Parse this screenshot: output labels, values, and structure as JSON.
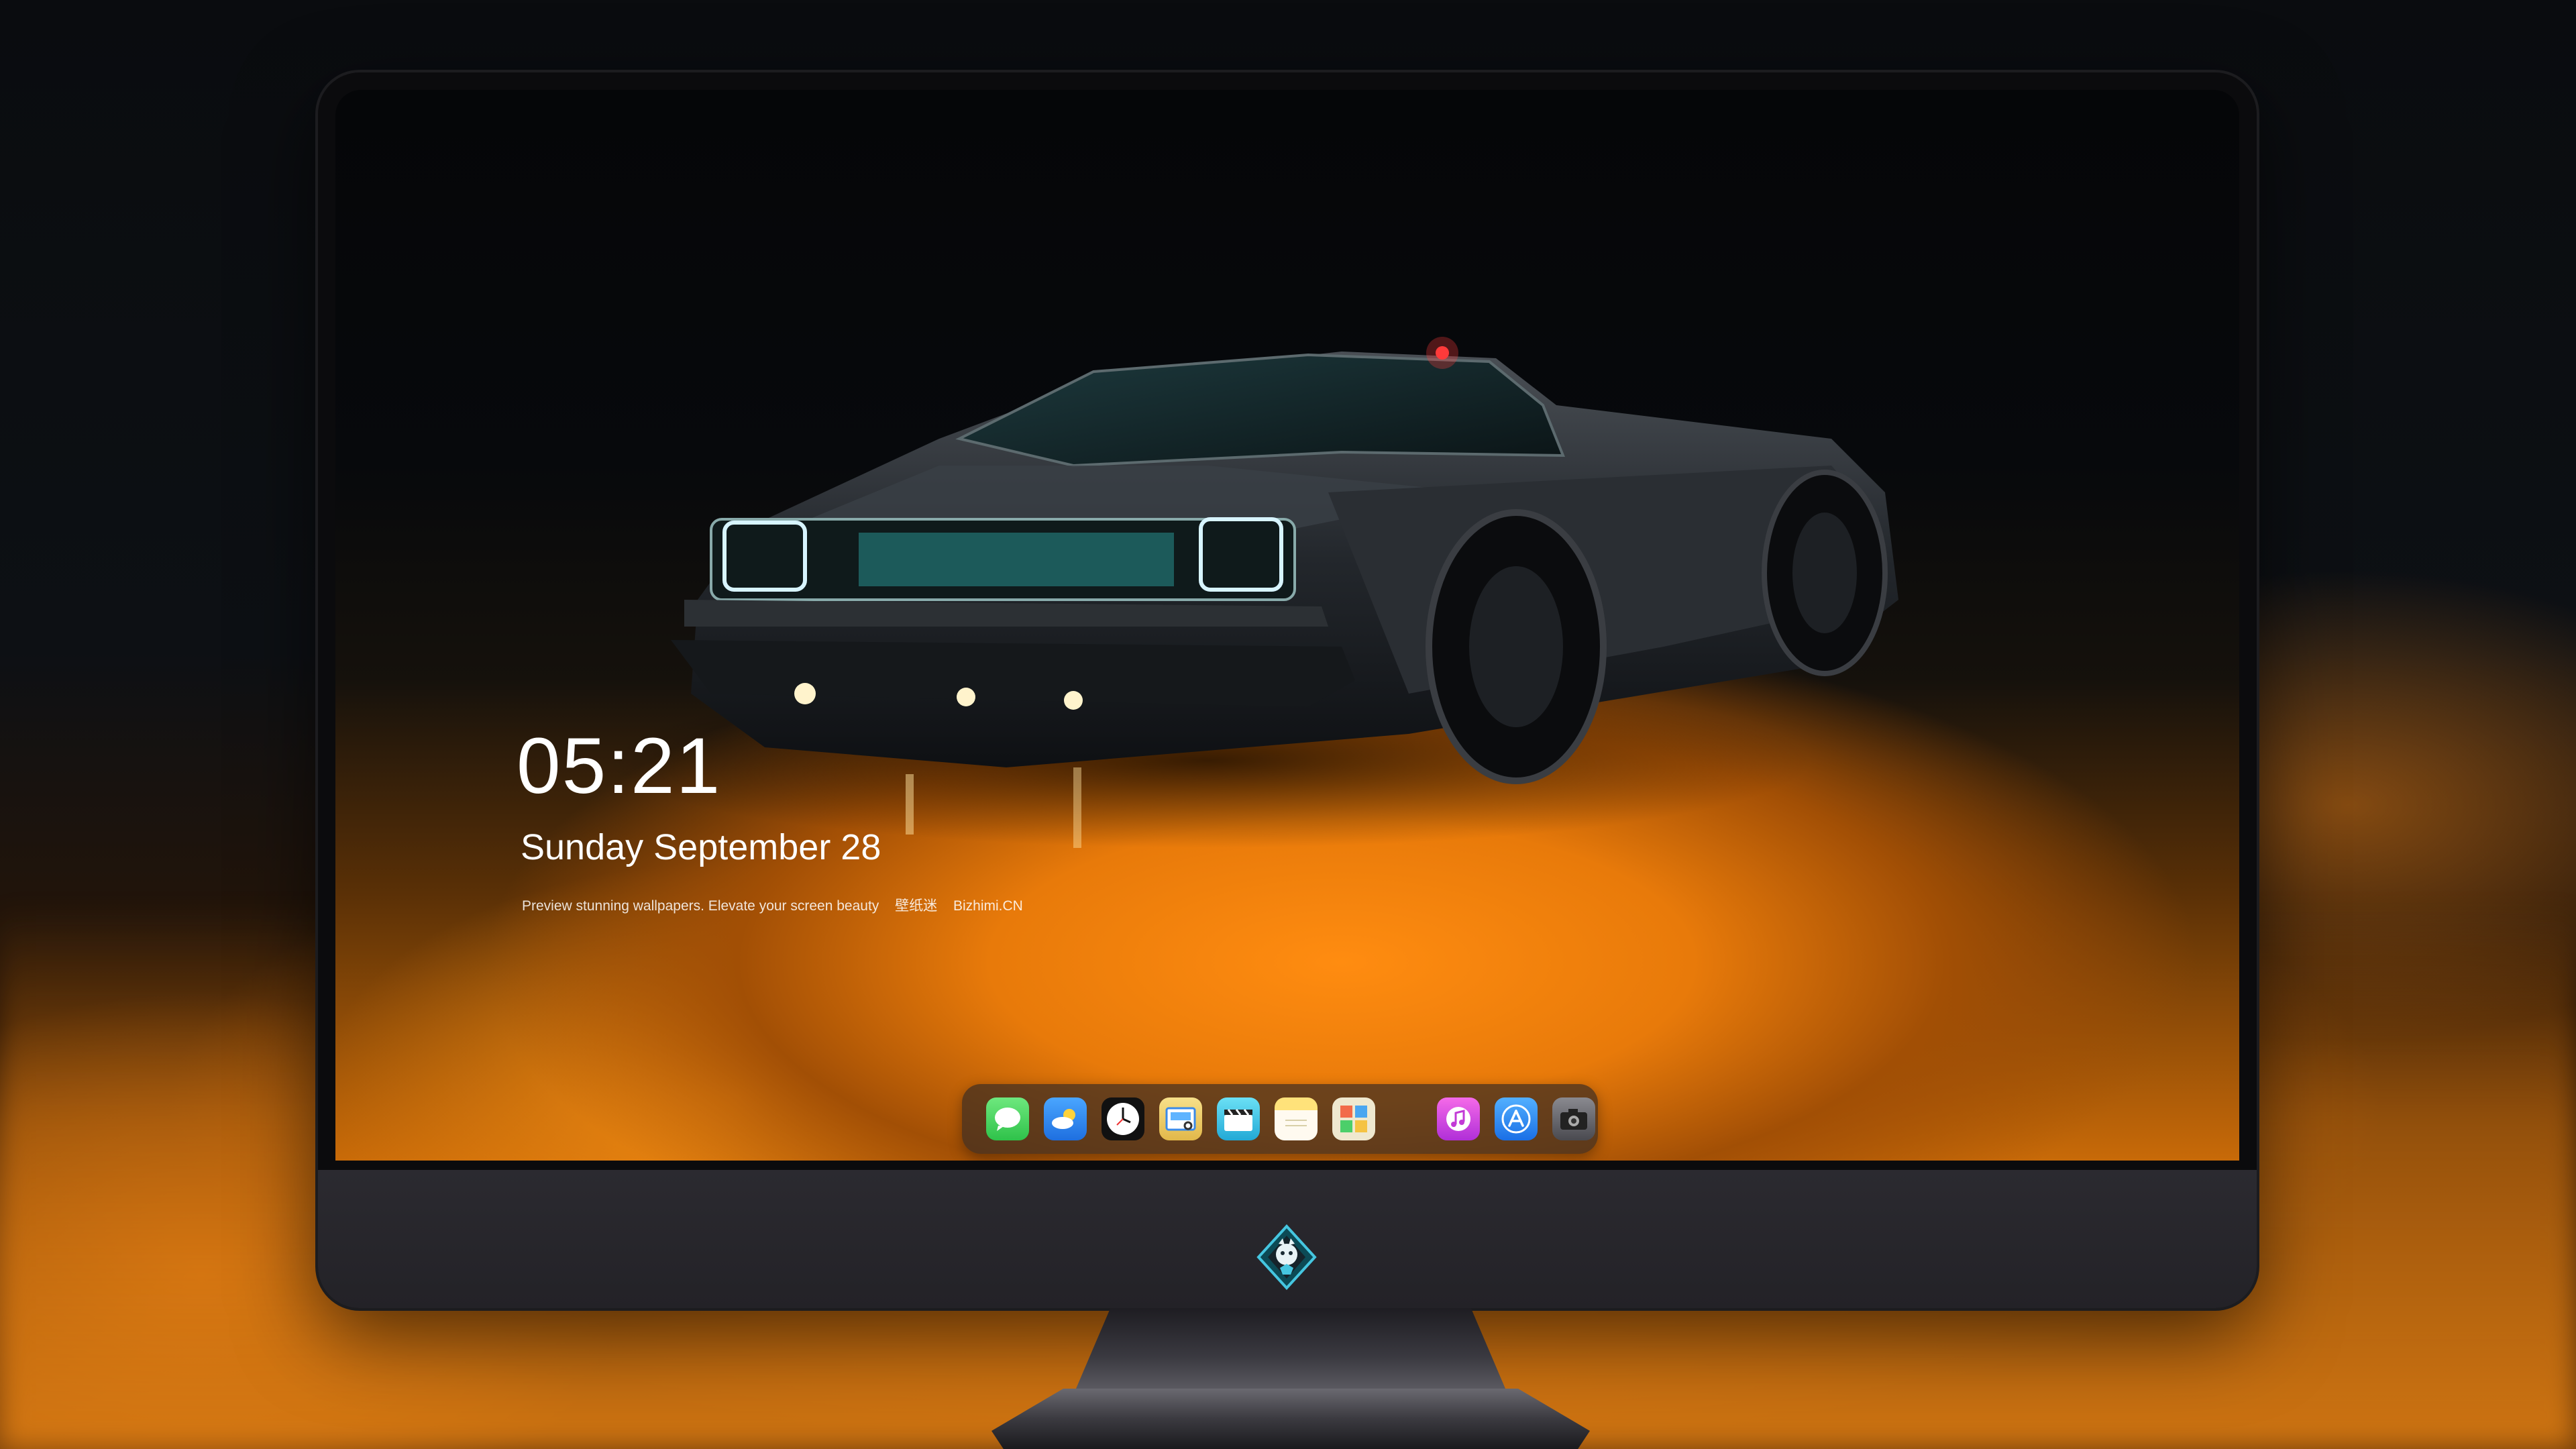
{
  "lock_screen": {
    "time": "05:21",
    "date": "Sunday September  28",
    "tagline": [
      "Preview stunning wallpapers. Elevate your screen beauty",
      "壁纸迷",
      "Bizhimi.CN"
    ]
  },
  "dock": {
    "apps": [
      {
        "name": "Messages",
        "icon": "messages-icon",
        "color": "#3fd35a"
      },
      {
        "name": "Weather",
        "icon": "weather-icon",
        "color": "#2a8cf0"
      },
      {
        "name": "Clock",
        "icon": "clock-icon",
        "color": "#111111"
      },
      {
        "name": "Preview",
        "icon": "preview-icon",
        "color": "#f2d16b"
      },
      {
        "name": "Claquette",
        "icon": "clapperboard-icon",
        "color": "#3fc6e8"
      },
      {
        "name": "Notes",
        "icon": "notes-icon",
        "color": "#ffd44a"
      },
      {
        "name": "Photo Booth",
        "icon": "photo-grid-icon",
        "color": "#e9e4c9"
      },
      {
        "name": "iTunes",
        "icon": "music-icon",
        "color": "#d646e0"
      },
      {
        "name": "App Store",
        "icon": "app-store-icon",
        "color": "#2e8cf3"
      },
      {
        "name": "Screenshot",
        "icon": "camera-icon",
        "color": "#6a6a6e"
      }
    ]
  },
  "colors": {
    "accent_orange": "#f08a12",
    "monitor_bezel": "#0b0b0d",
    "monitor_chin": "#2b2a30"
  }
}
